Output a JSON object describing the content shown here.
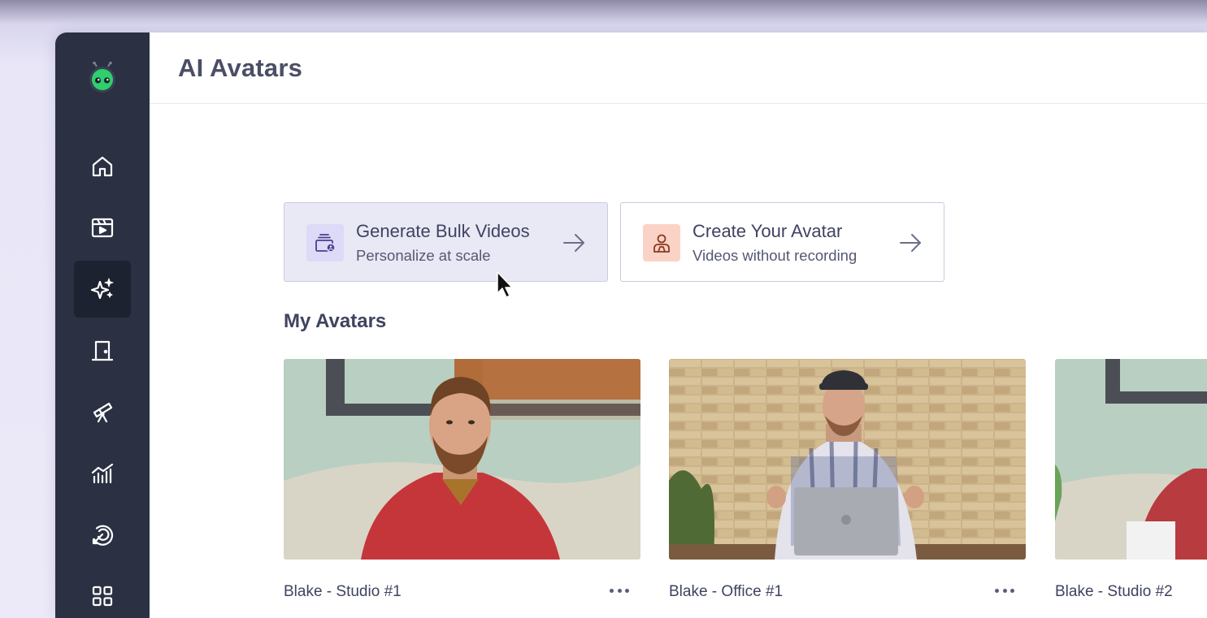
{
  "header": {
    "title": "AI Avatars"
  },
  "sidebar": {
    "items": [
      {
        "name": "home",
        "icon": "home-icon"
      },
      {
        "name": "videos",
        "icon": "video-clapper-icon"
      },
      {
        "name": "ai-avatars",
        "icon": "sparkles-icon",
        "active": true
      },
      {
        "name": "door",
        "icon": "door-icon"
      },
      {
        "name": "discover",
        "icon": "telescope-icon"
      },
      {
        "name": "analytics",
        "icon": "chart-icon"
      },
      {
        "name": "integrations",
        "icon": "target-arrow-icon"
      },
      {
        "name": "apps",
        "icon": "grid-icon"
      }
    ]
  },
  "actions": [
    {
      "title": "Generate Bulk Videos",
      "subtitle": "Personalize at scale",
      "icon": "bulk-videos-icon",
      "icon_bg": "#dcdaf7"
    },
    {
      "title": "Create Your Avatar",
      "subtitle": "Videos without recording",
      "icon": "avatar-person-icon",
      "icon_bg": "#fbd3c6"
    }
  ],
  "my_avatars": {
    "title": "My Avatars",
    "items": [
      {
        "name": "Blake - Studio #1"
      },
      {
        "name": "Blake - Office #1"
      },
      {
        "name": "Blake - Studio #2"
      }
    ]
  },
  "colors": {
    "sidebar_bg": "#2b3143",
    "accent": "#5b5fe0",
    "logo_green": "#2fcf6c"
  }
}
